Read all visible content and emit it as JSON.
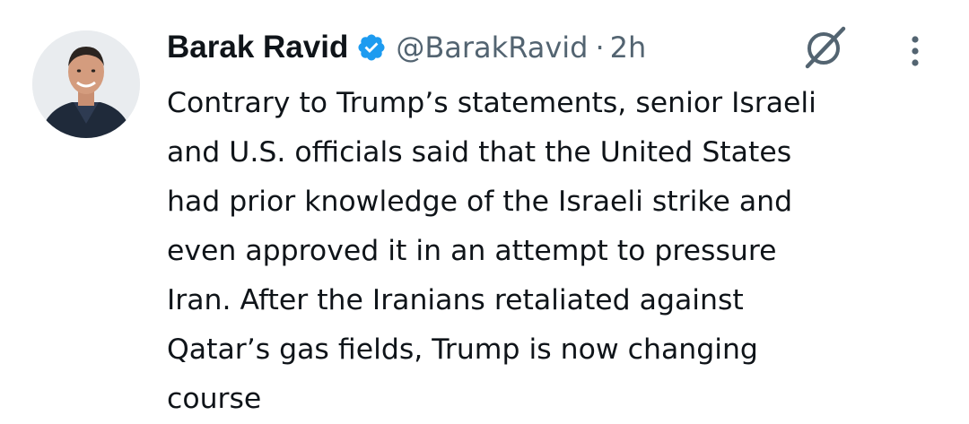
{
  "author": {
    "display_name": "Barak Ravid",
    "handle": "@BarakRavid",
    "separator": "·",
    "time": "2h",
    "verified": true
  },
  "icons": {
    "verified": "verified-badge-icon",
    "grok": "grok-icon",
    "more": "more-options-icon",
    "avatar": "profile-photo"
  },
  "colors": {
    "verified_blue": "#1d9bf0",
    "secondary_text": "#536471",
    "primary_text": "#0f1419"
  },
  "tweet": {
    "lines": [
      "Contrary to Trump’s statements, senior Israeli",
      "and U.S. officials said that the United States",
      "had prior knowledge of the Israeli strike and",
      "even approved it in an attempt to pressure",
      "Iran. After the Iranians retaliated against",
      "Qatar’s gas fields, Trump is now changing",
      "course"
    ]
  }
}
